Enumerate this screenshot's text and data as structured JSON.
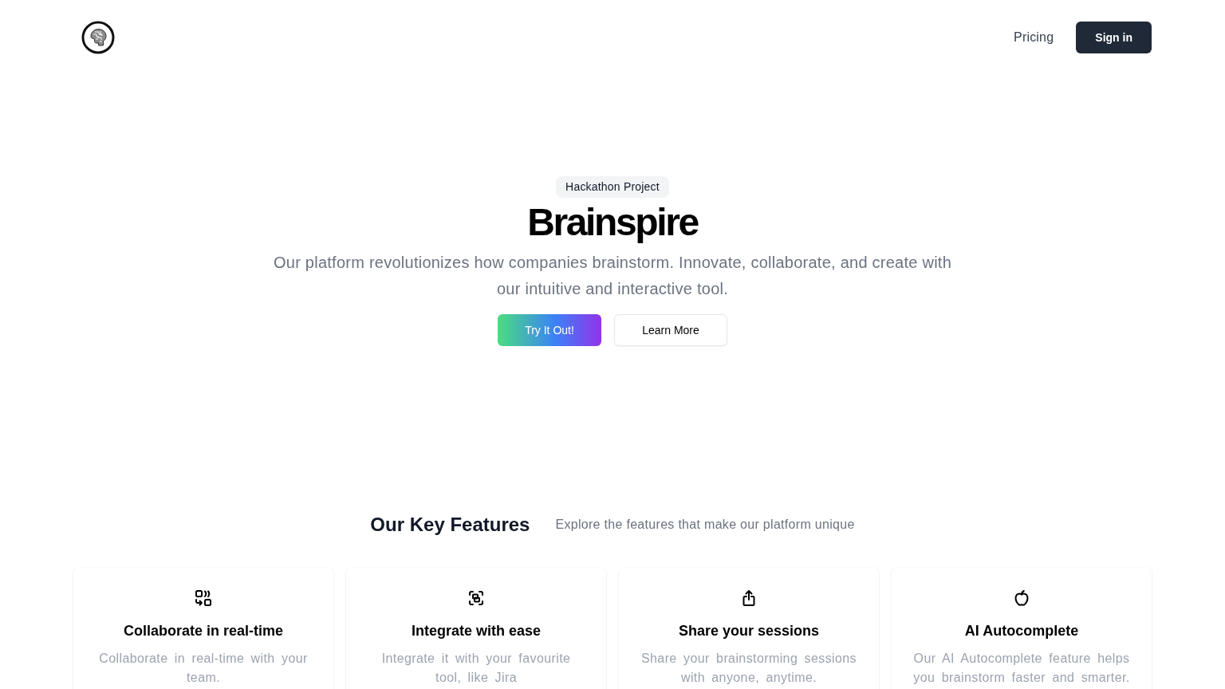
{
  "header": {
    "nav_links": [
      "Pricing"
    ],
    "sign_in_button": "Sign in"
  },
  "hero": {
    "badge": "Hackathon Project",
    "title": "Brainspire",
    "subtitle": "Our platform revolutionizes how companies brainstorm. Innovate, collaborate, and create with our intuitive and interactive tool.",
    "buttons": [
      {
        "label": "Try It Out!",
        "kind": "primary"
      },
      {
        "label": "Learn More",
        "kind": "secondary"
      }
    ]
  },
  "features": {
    "title": "Our Key Features",
    "subtitle": "Explore the features that make our platform unique",
    "cards": [
      {
        "title": "Collaborate in real-time",
        "description": "Collaborate in real-time with your team."
      },
      {
        "title": "Integrate with ease",
        "description": "Integrate it with your favourite tool, like Jira"
      },
      {
        "title": "Share your sessions",
        "description": "Share your brainstorming sessions with anyone, anytime."
      },
      {
        "title": "AI Autocomplete",
        "description": "Our AI Autocomplete feature helps you brainstorm faster and smarter."
      }
    ]
  }
}
